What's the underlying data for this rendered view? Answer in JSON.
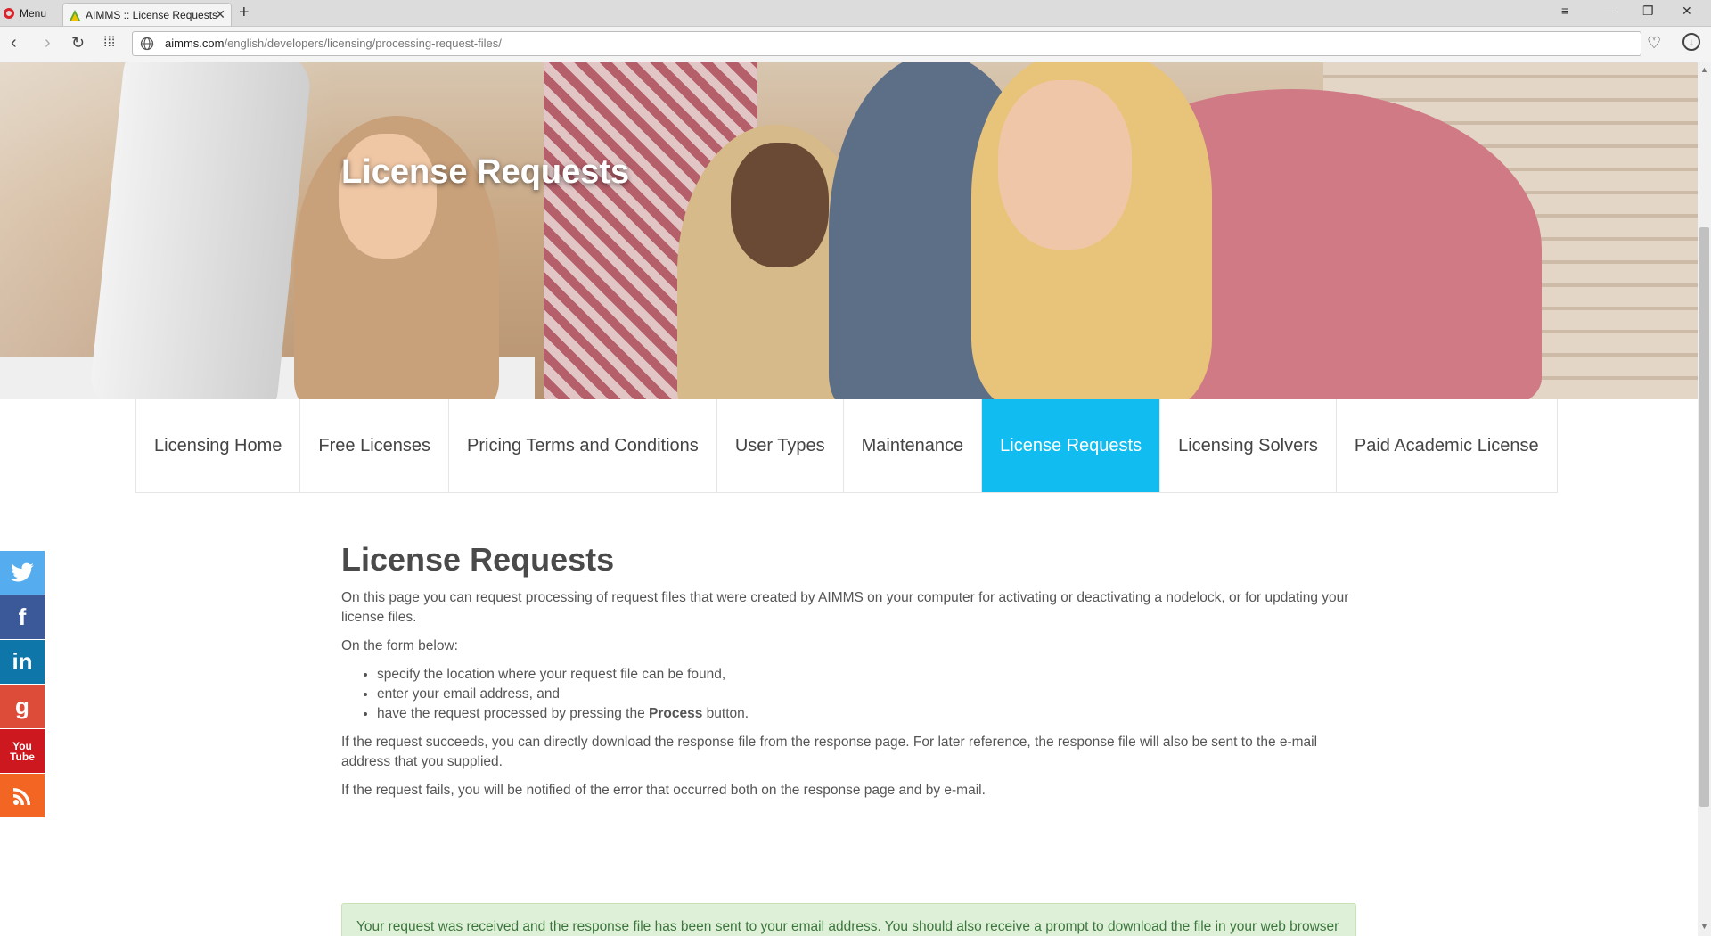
{
  "browser": {
    "menu_label": "Menu",
    "tab_title": "AIMMS :: License Requests",
    "url_domain": "aimms.com",
    "url_path": "/english/developers/licensing/processing-request-files/"
  },
  "hero": {
    "title": "License Requests"
  },
  "subnav": {
    "items": [
      {
        "label": "Licensing Home",
        "active": false
      },
      {
        "label": "Free Licenses",
        "active": false
      },
      {
        "label": "Pricing Terms and Conditions",
        "active": false
      },
      {
        "label": "User Types",
        "active": false
      },
      {
        "label": "Maintenance",
        "active": false
      },
      {
        "label": "License Requests",
        "active": true
      },
      {
        "label": "Licensing Solvers",
        "active": false
      },
      {
        "label": "Paid Academic License",
        "active": false
      }
    ],
    "active_color": "#11bdf0"
  },
  "social": {
    "items": [
      "twitter-icon",
      "facebook-icon",
      "linkedin-icon",
      "google-plus-icon",
      "youtube-icon",
      "rss-icon"
    ],
    "youtube_text": "You Tube"
  },
  "content": {
    "heading": "License Requests",
    "intro": "On this page you can request processing of request files that were created by AIMMS on your computer for activating or deactivating a nodelock, or for updating your license files.",
    "form_intro": "On the form below:",
    "steps": [
      "specify the location where your request file can be found,",
      "enter your email address, and"
    ],
    "step3_prefix": "have the request processed by pressing the ",
    "step3_bold": "Process",
    "step3_suffix": " button.",
    "success_text": "If the request succeeds, you can directly download the response file from the response page. For later reference, the response file will also be sent to the e-mail address that you supplied.",
    "fail_text": "If the request fails, you will be notified of the error that occurred both on the response page and by e-mail."
  },
  "alert": {
    "message": "Your request was received and the response file has been sent to your email address. You should also receive a prompt to download the file in your web browser shortly.",
    "bg_color": "#dff0d8",
    "text_color": "#3c763d"
  }
}
